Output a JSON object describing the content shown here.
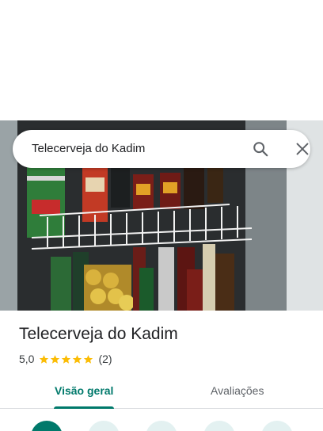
{
  "search": {
    "query": "Telecerveja do Kadim"
  },
  "place": {
    "name": "Telecerveja do Kadim",
    "rating": "5,0",
    "stars": 5,
    "reviews": "(2)"
  },
  "tabs": [
    {
      "label": "Visão geral",
      "active": true
    },
    {
      "label": "Avaliações",
      "active": false
    }
  ],
  "icons": {
    "search": "search-icon",
    "close": "close-icon",
    "star": "star-icon"
  },
  "colors": {
    "accent": "#00796b",
    "star": "#fbbc04",
    "action_bg": "#e3f1f1"
  }
}
